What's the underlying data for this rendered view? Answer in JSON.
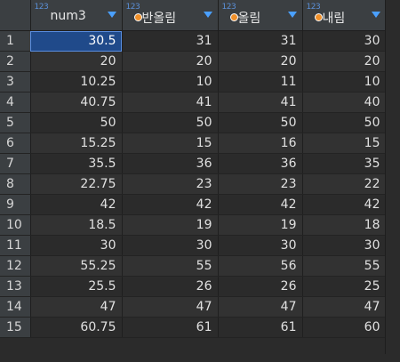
{
  "columns": [
    {
      "name": "num3",
      "type_badge": "123",
      "key": false
    },
    {
      "name": "반올림",
      "type_badge": "123",
      "key": true
    },
    {
      "name": "올림",
      "type_badge": "123",
      "key": true
    },
    {
      "name": "내림",
      "type_badge": "123",
      "key": true
    }
  ],
  "rows": [
    {
      "n": "1",
      "v": [
        "30.5",
        "31",
        "31",
        "30"
      ]
    },
    {
      "n": "2",
      "v": [
        "20",
        "20",
        "20",
        "20"
      ]
    },
    {
      "n": "3",
      "v": [
        "10.25",
        "10",
        "11",
        "10"
      ]
    },
    {
      "n": "4",
      "v": [
        "40.75",
        "41",
        "41",
        "40"
      ]
    },
    {
      "n": "5",
      "v": [
        "50",
        "50",
        "50",
        "50"
      ]
    },
    {
      "n": "6",
      "v": [
        "15.25",
        "15",
        "16",
        "15"
      ]
    },
    {
      "n": "7",
      "v": [
        "35.5",
        "36",
        "36",
        "35"
      ]
    },
    {
      "n": "8",
      "v": [
        "22.75",
        "23",
        "23",
        "22"
      ]
    },
    {
      "n": "9",
      "v": [
        "42",
        "42",
        "42",
        "42"
      ]
    },
    {
      "n": "10",
      "v": [
        "18.5",
        "19",
        "19",
        "18"
      ]
    },
    {
      "n": "11",
      "v": [
        "30",
        "30",
        "30",
        "30"
      ]
    },
    {
      "n": "12",
      "v": [
        "55.25",
        "55",
        "56",
        "55"
      ]
    },
    {
      "n": "13",
      "v": [
        "25.5",
        "26",
        "26",
        "25"
      ]
    },
    {
      "n": "14",
      "v": [
        "47",
        "47",
        "47",
        "47"
      ]
    },
    {
      "n": "15",
      "v": [
        "60.75",
        "61",
        "61",
        "60"
      ]
    }
  ],
  "selected_cell": {
    "row": 0,
    "col": 0
  },
  "colors": {
    "selection": "#204a8a",
    "key_icon": "#f0902a",
    "type_badge": "#5b8fd6",
    "sort_arrow": "#4aa0ff"
  },
  "icons": {
    "type_badge": "numeric-type-icon",
    "key": "key-dot-icon",
    "sort": "sort-dropdown-icon"
  }
}
